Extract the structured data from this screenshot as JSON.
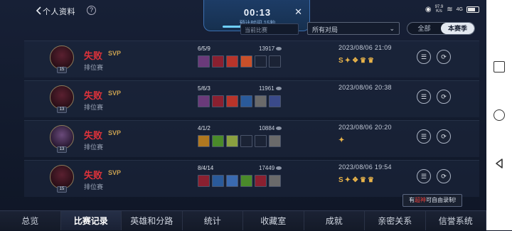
{
  "header": {
    "title": "个人资料",
    "help": "?",
    "timer": {
      "time": "00:13",
      "sub": "预计时间 15秒",
      "progress": 0.6
    },
    "status": {
      "speed_value": "97.9",
      "speed_unit": "K/s",
      "signal": "4G"
    }
  },
  "filters": {
    "left": "当前比赛",
    "select": "所有对局",
    "segment": [
      "全部",
      "本赛季"
    ],
    "active": "本赛季"
  },
  "matches": [
    {
      "result": "失败",
      "svp": "SVP",
      "mode": "排位赛",
      "level": "15",
      "kda": "6/5/9",
      "gold": "13917",
      "date": "2023/08/06 21:09",
      "badges": [
        "S",
        "✦",
        "❖",
        "♛",
        "♛"
      ]
    },
    {
      "result": "失败",
      "svp": "SVP",
      "mode": "排位赛",
      "level": "13",
      "kda": "5/6/3",
      "gold": "11961",
      "date": "2023/08/06 20:38",
      "badges": []
    },
    {
      "result": "失败",
      "svp": "SVP",
      "mode": "排位赛",
      "level": "13",
      "kda": "4/1/2",
      "gold": "10884",
      "date": "2023/08/06 20:20",
      "badges": [
        "✦"
      ]
    },
    {
      "result": "失败",
      "svp": "SVP",
      "mode": "排位赛",
      "level": "15",
      "kda": "8/4/14",
      "gold": "17449",
      "date": "2023/08/06 19:54",
      "badges": [
        "S",
        "✦",
        "❖",
        "♛",
        "♛"
      ]
    }
  ],
  "tooltip": {
    "pre": "有",
    "hl": "超神",
    "post": "可自由录制!"
  },
  "tabs": [
    "总览",
    "比赛记录",
    "英雄和分路",
    "统计",
    "收藏室",
    "成就",
    "亲密关系",
    "信誉系统"
  ],
  "active_tab": "比赛记录"
}
